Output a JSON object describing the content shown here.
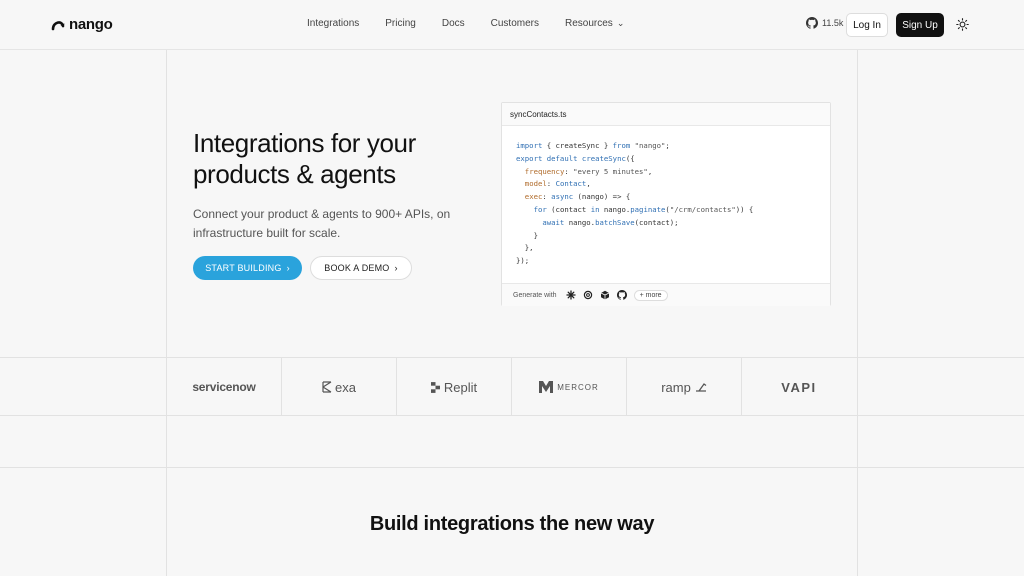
{
  "brand": {
    "name": "nango"
  },
  "nav": {
    "items": [
      "Integrations",
      "Pricing",
      "Docs",
      "Customers",
      "Resources"
    ]
  },
  "header": {
    "github_stars": "11.5k",
    "login_label": "Log In",
    "signup_label": "Sign Up"
  },
  "hero": {
    "title": "Integrations for your products & agents",
    "subtitle": "Connect your product & agents to 900+ APIs, on infrastructure built for scale.",
    "start_label": "START BUILDING",
    "demo_label": "BOOK A DEMO"
  },
  "code": {
    "filename": "syncContacts.ts",
    "generate_label": "Generate with",
    "more_label": "+ more",
    "lines": [
      "import { createSync } from \"nango\";",
      "export default createSync({",
      "  frequency: \"every 5 minutes\",",
      "  model: Contact,",
      "  exec: async (nango) => {",
      "    for (contact in nango.paginate(\"/crm/contacts\")) {",
      "      await nango.batchSave(contact);",
      "    }",
      "  },",
      "});"
    ]
  },
  "customers": [
    "servicenow",
    "exa",
    "Replit",
    "MERCOR",
    "ramp",
    "VAPI"
  ],
  "section": {
    "title": "Build integrations the new way"
  },
  "colors": {
    "accent": "#2aa3dc",
    "dark": "#111111",
    "background": "#f7f7f7"
  }
}
